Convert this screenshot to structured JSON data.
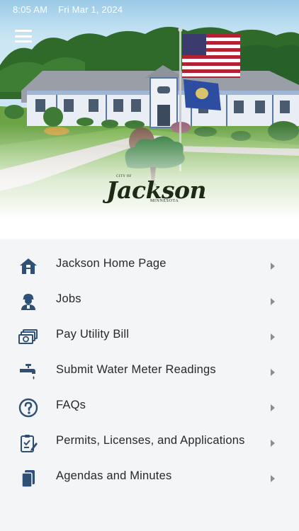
{
  "status_bar": {
    "time": "8:05 AM",
    "date": "Fri Mar 1, 2024"
  },
  "header": {
    "menu_icon": "hamburger-menu-icon"
  },
  "logo": {
    "small_text": "CITY OF",
    "name": "Jackson",
    "subtitle": "MINNESOTA"
  },
  "menu": {
    "items": [
      {
        "label": "Jackson Home Page",
        "icon": "home-icon"
      },
      {
        "label": "Jobs",
        "icon": "worker-icon"
      },
      {
        "label": "Pay Utility Bill",
        "icon": "money-icon"
      },
      {
        "label": "Submit Water Meter Readings",
        "icon": "faucet-icon"
      },
      {
        "label": "FAQs",
        "icon": "question-icon"
      },
      {
        "label": "Permits, Licenses, and Applications",
        "icon": "clipboard-edit-icon"
      },
      {
        "label": "Agendas and Minutes",
        "icon": "documents-icon"
      }
    ]
  },
  "colors": {
    "icon": "#2f4f75",
    "chevron": "#8a8d92",
    "text": "#26282b",
    "background": "#f4f5f7"
  }
}
